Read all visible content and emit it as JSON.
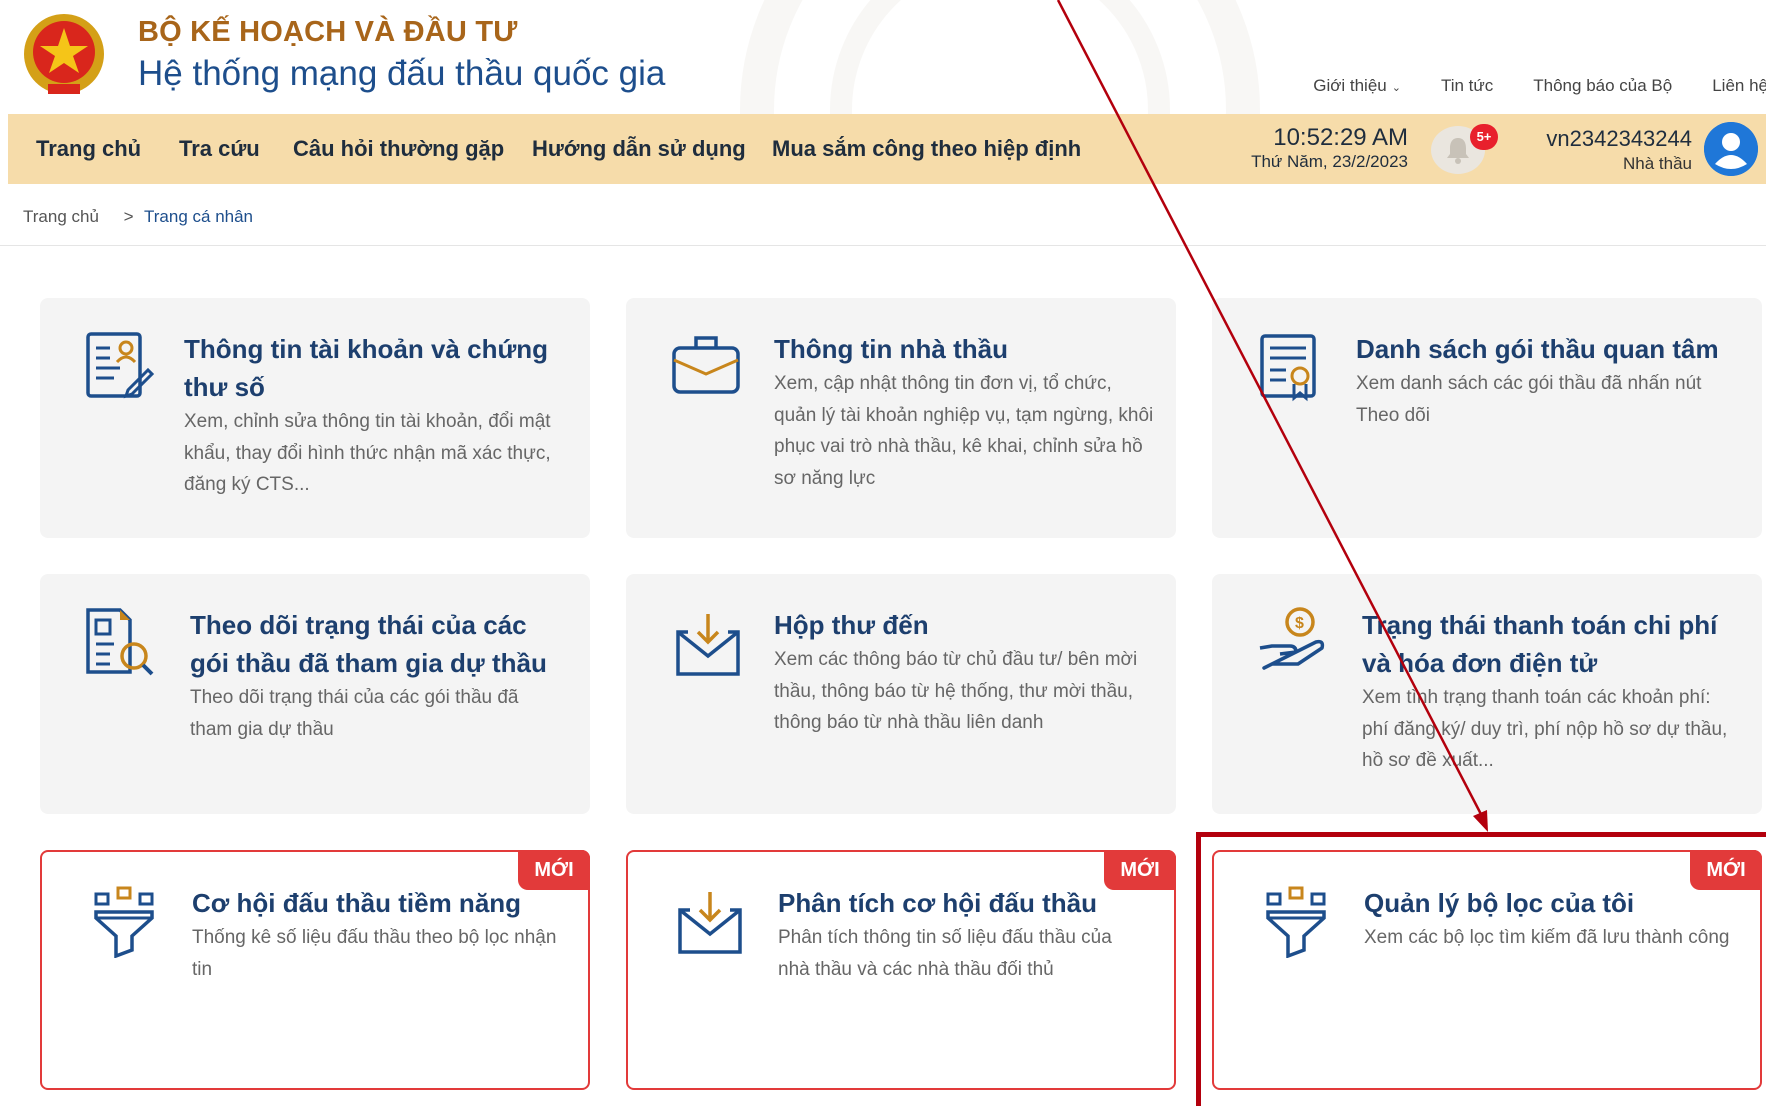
{
  "header": {
    "org_name": "BỘ KẾ HOẠCH VÀ ĐẦU TƯ",
    "site_name": "Hệ thống mạng đấu thầu quốc gia",
    "top_links": [
      {
        "label": "Giới thiệu",
        "has_dropdown": true
      },
      {
        "label": "Tin tức"
      },
      {
        "label": "Thông báo của Bộ"
      },
      {
        "label": "Liên hệ"
      }
    ]
  },
  "nav": {
    "items": [
      "Trang chủ",
      "Tra cứu",
      "Câu hỏi thường gặp",
      "Hướng dẫn sử dụng",
      "Mua sắm công theo hiệp định"
    ],
    "time": "10:52:29 AM",
    "date": "Thứ Năm, 23/2/2023",
    "notification_badge": "5+",
    "user_id": "vn2342343244",
    "user_role": "Nhà thầu"
  },
  "breadcrumb": {
    "home": "Trang chủ",
    "separator": ">",
    "current": "Trang cá nhân"
  },
  "cards": [
    {
      "icon": "account-certificate-icon",
      "title": "Thông tin tài khoản và chứng thư số",
      "desc": "Xem, chỉnh sửa thông tin tài khoản, đổi mật khẩu, thay đổi hình thức nhận mã xác thực, đăng ký CTS...",
      "is_new": false
    },
    {
      "icon": "briefcase-icon",
      "title": "Thông tin nhà thầu",
      "desc": "Xem, cập nhật thông tin đơn vị, tổ chức, quản lý tài khoản nghiệp vụ, tạm ngừng, khôi phục vai trò nhà thầu, kê khai, chỉnh sửa hồ sơ năng lực",
      "is_new": false
    },
    {
      "icon": "certificate-list-icon",
      "title": "Danh sách gói thầu quan tâm",
      "desc": "Xem danh sách các gói thầu đã nhấn nút Theo dõi",
      "is_new": false
    },
    {
      "icon": "document-search-icon",
      "title": "Theo dõi trạng thái của các gói thầu đã tham gia dự thầu",
      "desc": "Theo dõi trạng thái của các gói thầu đã tham gia dự thầu",
      "is_new": false
    },
    {
      "icon": "inbox-download-icon",
      "title": "Hộp thư đến",
      "desc": "Xem các thông báo từ chủ đầu tư/ bên mời thầu, thông báo từ hệ thống, thư mời thầu, thông báo từ nhà thầu liên danh",
      "is_new": false
    },
    {
      "icon": "payment-hand-icon",
      "title": "Trạng thái thanh toán chi phí và hóa đơn điện tử",
      "desc": "Xem tình trạng thanh toán các khoản phí: phí đăng ký/ duy trì, phí nộp hồ sơ dự thầu, hồ sơ đề xuất...",
      "is_new": false
    },
    {
      "icon": "filter-funnel-icon",
      "title": "Cơ hội đấu thầu tiềm năng",
      "desc": "Thống kê số liệu đấu thầu theo bộ lọc nhận tin",
      "is_new": true,
      "new_label": "MỚI"
    },
    {
      "icon": "inbox-download-icon",
      "title": "Phân tích cơ hội đấu thầu",
      "desc": "Phân tích thông tin số liệu đấu thầu của nhà thầu và các nhà thầu đối thủ",
      "is_new": true,
      "new_label": "MỚI"
    },
    {
      "icon": "filter-funnel-icon",
      "title": "Quản lý bộ lọc của tôi",
      "desc": "Xem các bộ lọc tìm kiếm đã lưu thành công",
      "is_new": true,
      "new_label": "MỚI"
    }
  ],
  "colors": {
    "brand_blue": "#1d4e8c",
    "org_brown": "#a8651a",
    "nav_bg": "#f6dcaa",
    "new_red": "#e23a3a",
    "annotation_red": "#b3000d"
  }
}
